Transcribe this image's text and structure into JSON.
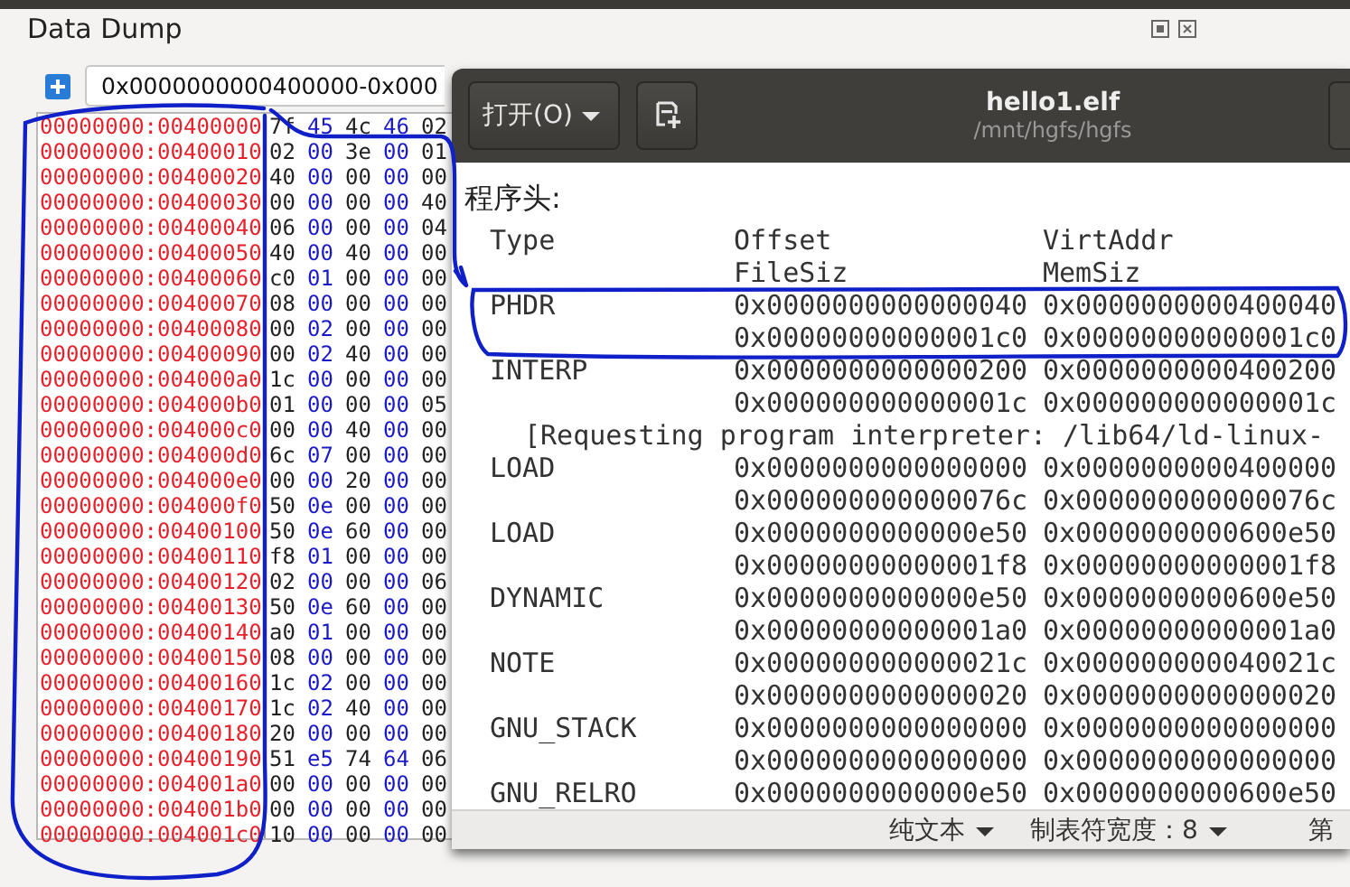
{
  "data_dump": {
    "title": "Data Dump",
    "range": "0x0000000000400000-0x000",
    "rows": [
      {
        "address": "00000000:00400000",
        "bytes": [
          "7f",
          "45",
          "4c",
          "46",
          "02"
        ]
      },
      {
        "address": "00000000:00400010",
        "bytes": [
          "02",
          "00",
          "3e",
          "00",
          "01"
        ]
      },
      {
        "address": "00000000:00400020",
        "bytes": [
          "40",
          "00",
          "00",
          "00",
          "00"
        ]
      },
      {
        "address": "00000000:00400030",
        "bytes": [
          "00",
          "00",
          "00",
          "00",
          "40"
        ]
      },
      {
        "address": "00000000:00400040",
        "bytes": [
          "06",
          "00",
          "00",
          "00",
          "04"
        ]
      },
      {
        "address": "00000000:00400050",
        "bytes": [
          "40",
          "00",
          "40",
          "00",
          "00"
        ]
      },
      {
        "address": "00000000:00400060",
        "bytes": [
          "c0",
          "01",
          "00",
          "00",
          "00"
        ]
      },
      {
        "address": "00000000:00400070",
        "bytes": [
          "08",
          "00",
          "00",
          "00",
          "00"
        ]
      },
      {
        "address": "00000000:00400080",
        "bytes": [
          "00",
          "02",
          "00",
          "00",
          "00"
        ]
      },
      {
        "address": "00000000:00400090",
        "bytes": [
          "00",
          "02",
          "40",
          "00",
          "00"
        ]
      },
      {
        "address": "00000000:004000a0",
        "bytes": [
          "1c",
          "00",
          "00",
          "00",
          "00"
        ]
      },
      {
        "address": "00000000:004000b0",
        "bytes": [
          "01",
          "00",
          "00",
          "00",
          "05"
        ]
      },
      {
        "address": "00000000:004000c0",
        "bytes": [
          "00",
          "00",
          "40",
          "00",
          "00"
        ]
      },
      {
        "address": "00000000:004000d0",
        "bytes": [
          "6c",
          "07",
          "00",
          "00",
          "00"
        ]
      },
      {
        "address": "00000000:004000e0",
        "bytes": [
          "00",
          "00",
          "20",
          "00",
          "00"
        ]
      },
      {
        "address": "00000000:004000f0",
        "bytes": [
          "50",
          "0e",
          "00",
          "00",
          "00"
        ]
      },
      {
        "address": "00000000:00400100",
        "bytes": [
          "50",
          "0e",
          "60",
          "00",
          "00"
        ]
      },
      {
        "address": "00000000:00400110",
        "bytes": [
          "f8",
          "01",
          "00",
          "00",
          "00"
        ]
      },
      {
        "address": "00000000:00400120",
        "bytes": [
          "02",
          "00",
          "00",
          "00",
          "06"
        ]
      },
      {
        "address": "00000000:00400130",
        "bytes": [
          "50",
          "0e",
          "60",
          "00",
          "00"
        ]
      },
      {
        "address": "00000000:00400140",
        "bytes": [
          "a0",
          "01",
          "00",
          "00",
          "00"
        ]
      },
      {
        "address": "00000000:00400150",
        "bytes": [
          "08",
          "00",
          "00",
          "00",
          "00"
        ]
      },
      {
        "address": "00000000:00400160",
        "bytes": [
          "1c",
          "02",
          "00",
          "00",
          "00"
        ]
      },
      {
        "address": "00000000:00400170",
        "bytes": [
          "1c",
          "02",
          "40",
          "00",
          "00"
        ]
      },
      {
        "address": "00000000:00400180",
        "bytes": [
          "20",
          "00",
          "00",
          "00",
          "00"
        ]
      },
      {
        "address": "00000000:00400190",
        "bytes": [
          "51",
          "e5",
          "74",
          "64",
          "06"
        ]
      },
      {
        "address": "00000000:004001a0",
        "bytes": [
          "00",
          "00",
          "00",
          "00",
          "00"
        ]
      },
      {
        "address": "00000000:004001b0",
        "bytes": [
          "00",
          "00",
          "00",
          "00",
          "00"
        ]
      },
      {
        "address": "00000000:004001c0",
        "bytes": [
          "10",
          "00",
          "00",
          "00",
          "00"
        ]
      }
    ]
  },
  "editor": {
    "open_button": "打开(O)",
    "title": "hello1.elf",
    "subtitle": "/mnt/hgfs/hgfs",
    "heading": "程序头:",
    "header": {
      "type": "Type",
      "offset": "Offset",
      "virt_addr": "VirtAddr",
      "file_size": "FileSiz",
      "mem_size": "MemSiz"
    },
    "entries": [
      {
        "kind": "segment",
        "type": "PHDR",
        "offset": "0x0000000000000040",
        "virt_addr": "0x0000000000400040",
        "file_size": "0x00000000000001c0",
        "mem_size": "0x00000000000001c0"
      },
      {
        "kind": "segment",
        "type": "INTERP",
        "offset": "0x0000000000000200",
        "virt_addr": "0x0000000000400200",
        "file_size": "0x000000000000001c",
        "mem_size": "0x000000000000001c"
      },
      {
        "kind": "note",
        "text": "[Requesting program interpreter: /lib64/ld-linux-"
      },
      {
        "kind": "segment",
        "type": "LOAD",
        "offset": "0x0000000000000000",
        "virt_addr": "0x0000000000400000",
        "file_size": "0x000000000000076c",
        "mem_size": "0x000000000000076c"
      },
      {
        "kind": "segment",
        "type": "LOAD",
        "offset": "0x0000000000000e50",
        "virt_addr": "0x0000000000600e50",
        "file_size": "0x00000000000001f8",
        "mem_size": "0x00000000000001f8"
      },
      {
        "kind": "segment",
        "type": "DYNAMIC",
        "offset": "0x0000000000000e50",
        "virt_addr": "0x0000000000600e50",
        "file_size": "0x00000000000001a0",
        "mem_size": "0x00000000000001a0"
      },
      {
        "kind": "segment",
        "type": "NOTE",
        "offset": "0x000000000000021c",
        "virt_addr": "0x000000000040021c",
        "file_size": "0x0000000000000020",
        "mem_size": "0x0000000000000020"
      },
      {
        "kind": "segment",
        "type": "GNU_STACK",
        "offset": "0x0000000000000000",
        "virt_addr": "0x0000000000000000",
        "file_size": "0x0000000000000000",
        "mem_size": "0x0000000000000000"
      },
      {
        "kind": "segment",
        "type": "GNU_RELRO",
        "offset": "0x0000000000000e50",
        "virt_addr": "0x0000000000600e50"
      }
    ],
    "status_bar": {
      "syntax": "纯文本",
      "tab_width": "制表符宽度：8",
      "position": "第"
    }
  }
}
